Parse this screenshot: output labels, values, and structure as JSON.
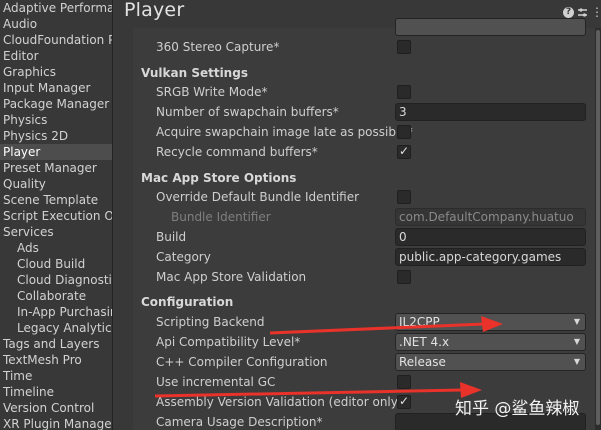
{
  "sidebar": {
    "items": [
      {
        "label": "Adaptive Performance",
        "sub": false,
        "selected": false
      },
      {
        "label": "Audio",
        "sub": false,
        "selected": false
      },
      {
        "label": "CloudFoundation Pl",
        "sub": false,
        "selected": false
      },
      {
        "label": "Editor",
        "sub": false,
        "selected": false
      },
      {
        "label": "Graphics",
        "sub": false,
        "selected": false
      },
      {
        "label": "Input Manager",
        "sub": false,
        "selected": false
      },
      {
        "label": "Package Manager",
        "sub": false,
        "selected": false
      },
      {
        "label": "Physics",
        "sub": false,
        "selected": false
      },
      {
        "label": "Physics 2D",
        "sub": false,
        "selected": false
      },
      {
        "label": "Player",
        "sub": false,
        "selected": true
      },
      {
        "label": "Preset Manager",
        "sub": false,
        "selected": false
      },
      {
        "label": "Quality",
        "sub": false,
        "selected": false
      },
      {
        "label": "Scene Template",
        "sub": false,
        "selected": false
      },
      {
        "label": "Script Execution Ord",
        "sub": false,
        "selected": false
      },
      {
        "label": "Services",
        "sub": false,
        "selected": false
      },
      {
        "label": "Ads",
        "sub": true,
        "selected": false
      },
      {
        "label": "Cloud Build",
        "sub": true,
        "selected": false
      },
      {
        "label": "Cloud Diagnostics",
        "sub": true,
        "selected": false
      },
      {
        "label": "Collaborate",
        "sub": true,
        "selected": false
      },
      {
        "label": "In-App Purchasing",
        "sub": true,
        "selected": false
      },
      {
        "label": "Legacy Analytics",
        "sub": true,
        "selected": false
      },
      {
        "label": "Tags and Layers",
        "sub": false,
        "selected": false
      },
      {
        "label": "TextMesh Pro",
        "sub": false,
        "selected": false
      },
      {
        "label": "Time",
        "sub": false,
        "selected": false
      },
      {
        "label": "Timeline",
        "sub": false,
        "selected": false
      },
      {
        "label": "Version Control",
        "sub": false,
        "selected": false
      },
      {
        "label": "XR Plugin Management",
        "sub": false,
        "selected": false
      }
    ]
  },
  "header": {
    "title": "Player",
    "help_icon": "help-icon",
    "preset_icon": "preset-icon",
    "more_icon": "more-icon"
  },
  "settings": {
    "stereo_capture": {
      "label": "360 Stereo Capture*",
      "checked": false
    },
    "vulkan": {
      "title": "Vulkan Settings",
      "srgb_write": {
        "label": "SRGB Write Mode*",
        "checked": false
      },
      "swapchain_buffers": {
        "label": "Number of swapchain buffers*",
        "value": "3"
      },
      "acquire_late": {
        "label": "Acquire swapchain image late as possible*",
        "checked": false
      },
      "recycle_buffers": {
        "label": "Recycle command buffers*",
        "checked": true
      }
    },
    "mac_store": {
      "title": "Mac App Store Options",
      "override_bundle": {
        "label": "Override Default Bundle Identifier",
        "checked": false
      },
      "bundle_identifier": {
        "label": "Bundle Identifier",
        "value": "com.DefaultCompany.huatuo"
      },
      "build": {
        "label": "Build",
        "value": "0"
      },
      "category": {
        "label": "Category",
        "value": "public.app-category.games"
      },
      "validation": {
        "label": "Mac App Store Validation",
        "checked": false
      }
    },
    "configuration": {
      "title": "Configuration",
      "scripting_backend": {
        "label": "Scripting Backend",
        "value": "IL2CPP"
      },
      "api_compat": {
        "label": "Api Compatibility Level*",
        "value": ".NET 4.x"
      },
      "cpp_compiler": {
        "label": "C++ Compiler Configuration",
        "value": "Release"
      },
      "incremental_gc": {
        "label": "Use incremental GC",
        "checked": false
      },
      "assembly_validation": {
        "label": "Assembly Version Validation (editor only)",
        "checked": true
      },
      "camera_usage": {
        "label": "Camera Usage Description*",
        "value": ""
      }
    }
  },
  "annotation": {
    "arrow_color": "#e8322a"
  },
  "watermark": {
    "text": "知乎 @鲨鱼辣椒"
  }
}
